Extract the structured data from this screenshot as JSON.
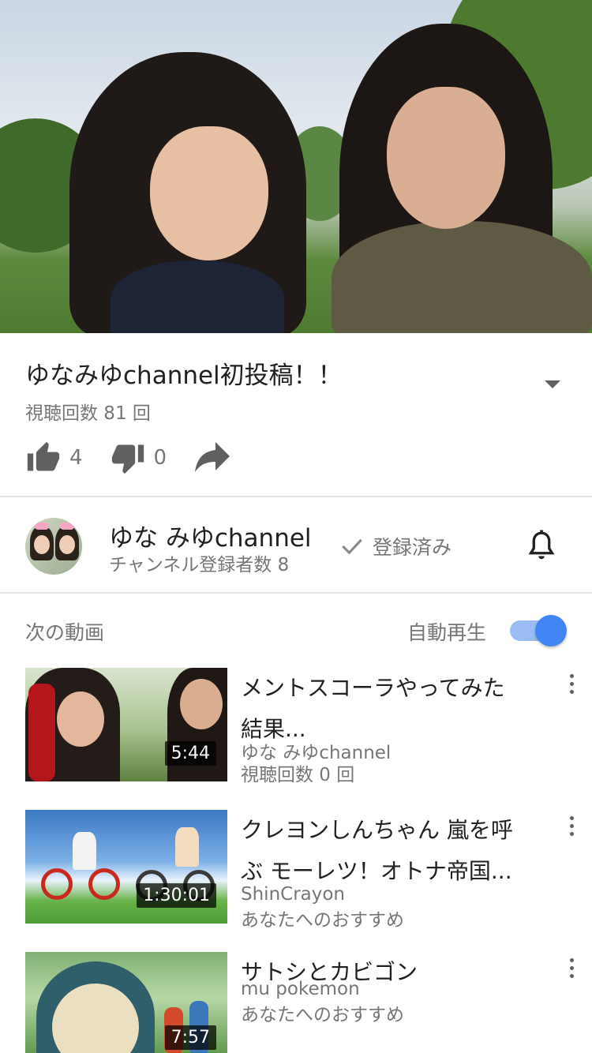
{
  "video": {
    "title": "ゆなみゆchannel初投稿！！",
    "views": "視聴回数 81 回",
    "likes": "4",
    "dislikes": "0"
  },
  "channel": {
    "name": "ゆな みゆchannel",
    "subscribers": "チャンネル登録者数 8",
    "subscribed_label": "登録済み"
  },
  "up_next": {
    "label": "次の動画",
    "autoplay_label": "自動再生",
    "autoplay_on": true,
    "items": [
      {
        "title_line1": "メントスコーラやってみた",
        "title_line2": "結果...",
        "channel": "ゆな みゆchannel",
        "meta": "視聴回数 0 回",
        "duration": "5:44"
      },
      {
        "title_line1": "クレヨンしんちゃん 嵐を呼",
        "title_line2": "ぶ モーレツ！オトナ帝国...",
        "channel": "ShinCrayon",
        "meta": "あなたへのおすすめ",
        "duration": "1:30:01"
      },
      {
        "title_line1": "サトシとカビゴン",
        "title_line2": "",
        "channel": "mu pokemon",
        "meta": "あなたへのおすすめ",
        "duration": "7:57"
      }
    ]
  },
  "colors": {
    "accent": "#4285f4",
    "text_primary": "#212121",
    "text_secondary": "#767676",
    "icon": "#606060"
  },
  "icons": {
    "like": "thumb-up-icon",
    "dislike": "thumb-down-icon",
    "share": "share-arrow-icon",
    "subscribed": "check-icon",
    "notifications": "bell-icon",
    "expand": "caret-down-icon",
    "more": "more-vert-icon"
  }
}
